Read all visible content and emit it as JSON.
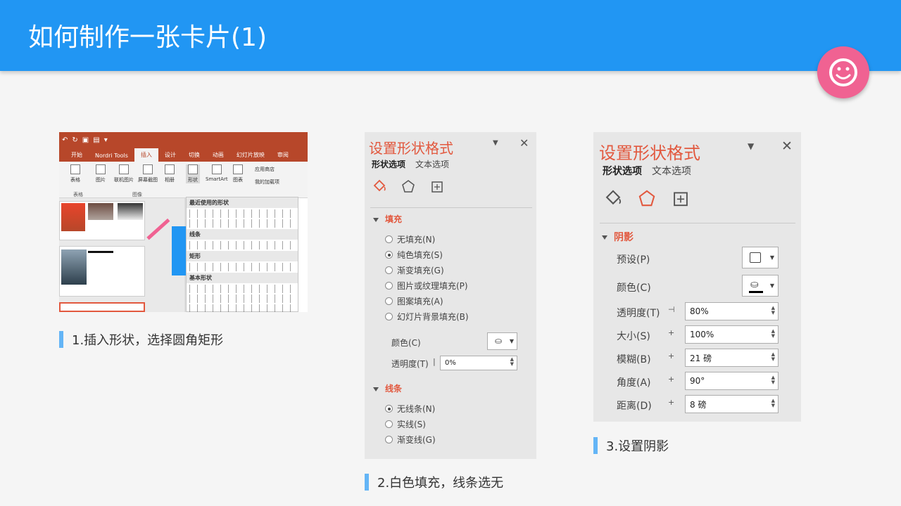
{
  "header": {
    "title": "如何制作一张卡片(1)"
  },
  "captions": {
    "step1": "1.插入形状，选择圆角矩形",
    "step2": "2.白色填充，线条选无",
    "step3": "3.设置阴影"
  },
  "ribbon": {
    "tabs": [
      "开始",
      "Nordri Tools",
      "插入",
      "设计",
      "切换",
      "动画",
      "幻灯片放映",
      "审阅"
    ],
    "active_tab": "插入",
    "buttons": [
      "表格",
      "图片",
      "联机图片",
      "屏幕截图",
      "相册",
      "形状",
      "SmartArt",
      "图表"
    ],
    "addins": [
      "应用商店",
      "我的加载项"
    ],
    "groups": [
      "表格",
      "图像"
    ],
    "gallery_headers": [
      "最近使用的形状",
      "线条",
      "矩形",
      "基本形状"
    ]
  },
  "pane2": {
    "title": "设置形状格式",
    "tab_shape": "形状选项",
    "tab_text": "文本选项",
    "fill_header": "填充",
    "fill_options": [
      "无填充(N)",
      "纯色填充(S)",
      "渐变填充(G)",
      "图片或纹理填充(P)",
      "图案填充(A)",
      "幻灯片背景填充(B)"
    ],
    "color_label": "颜色(C)",
    "transparency_label": "透明度(T)",
    "transparency_value": "0%",
    "line_header": "线条",
    "line_options": [
      "无线条(N)",
      "实线(S)",
      "渐变线(G)"
    ]
  },
  "pane3": {
    "title": "设置形状格式",
    "tab_shape": "形状选项",
    "tab_text": "文本选项",
    "shadow_header": "阴影",
    "preset_label": "预设(P)",
    "color_label": "颜色(C)",
    "transparency_label": "透明度(T)",
    "transparency_value": "80%",
    "size_label": "大小(S)",
    "size_value": "100%",
    "blur_label": "模糊(B)",
    "blur_value": "21 磅",
    "angle_label": "角度(A)",
    "angle_value": "90°",
    "distance_label": "距离(D)",
    "distance_value": "8 磅"
  },
  "colors": {
    "header": "#2196f3",
    "smiley": "#f06292",
    "accent": "#e2583e",
    "caption_bar": "#64b5f6"
  },
  "icons": [
    "smiley-icon",
    "fill-bucket-icon",
    "pentagon-icon",
    "size-properties-icon",
    "close-icon",
    "dropdown-arrow-icon"
  ]
}
